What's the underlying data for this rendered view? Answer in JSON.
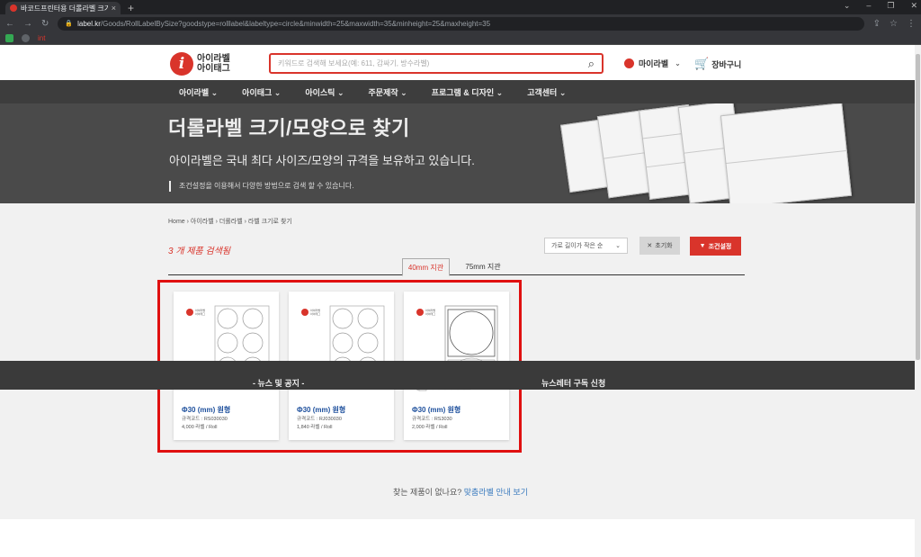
{
  "browser": {
    "tab_title": "바코드프린터용 더롤라벨 크기/모",
    "tab_close": "×",
    "new_tab": "+",
    "window_controls": [
      "⌄",
      "–",
      "❐",
      "✕"
    ],
    "url_domain": "label.kr",
    "url_path": "/Goods/RollLabelBySize?goodstype=rolllabel&labeltype=circle&minwidth=25&maxwidth=35&minheight=25&maxheight=35",
    "bookmark_label": "int"
  },
  "header": {
    "logo_line1": "아이라벨",
    "logo_line2": "아이태그",
    "search_placeholder": "키워드로 검색해 보세요(예: 611, 감싸기, 방수라벨)",
    "user_label": "마이라벨",
    "cart_label": "장바구니"
  },
  "nav": {
    "items": [
      "아이라벨 ⌄",
      "아이태그 ⌄",
      "아이스틱 ⌄",
      "주문제작 ⌄",
      "프로그램 & 디자인 ⌄",
      "고객센터 ⌄"
    ]
  },
  "hero": {
    "title": "더롤라벨 크기/모양으로 찾기",
    "subtitle": "아이라벨은 국내 최다 사이즈/모양의 규격을 보유하고 있습니다.",
    "note": "조건설정을 이용해서 다양한 방법으로 검색 할 수 있습니다."
  },
  "filter": {
    "breadcrumb": "Home › 아이라벨 › 더롤라벨 › 라벨 크기로 찾기",
    "result_count": "3 개 제품 검색됨",
    "sort_value": "가로 길이가 작은 순",
    "reset_label": "초기화",
    "condition_label": "조건설정",
    "tabs": [
      "40mm 지관",
      "75mm 지관"
    ]
  },
  "products": [
    {
      "name": "Φ30 (mm) 원형",
      "code": "규격코드 : RS030030",
      "qty": "4,000 라벨 / Roll"
    },
    {
      "name": "Φ30 (mm) 원형",
      "code": "규격코드 : RJ030030",
      "qty": "1,840 라벨 / Roll"
    },
    {
      "name": "Φ30 (mm) 원형",
      "code": "규격코드 : RS3030",
      "qty": "2,000 라벨 / Roll"
    }
  ],
  "card_logo": {
    "line1": "아이라벨",
    "line2": "아이태그"
  },
  "card_badge": "더롤",
  "help": {
    "question": "찾는 제품이 없나요? ",
    "link": "맞춤라벨 안내 보기"
  },
  "footer": {
    "news": "- 뉴스 및 공지 -",
    "newsletter": "뉴스레터 구독 신청"
  },
  "colors": {
    "brand_red": "#d9342b",
    "nav_bg": "#3d3d3d",
    "hero_bg": "#4a4a4a",
    "link_blue": "#1d4f9c",
    "highlight": "#e01010"
  }
}
